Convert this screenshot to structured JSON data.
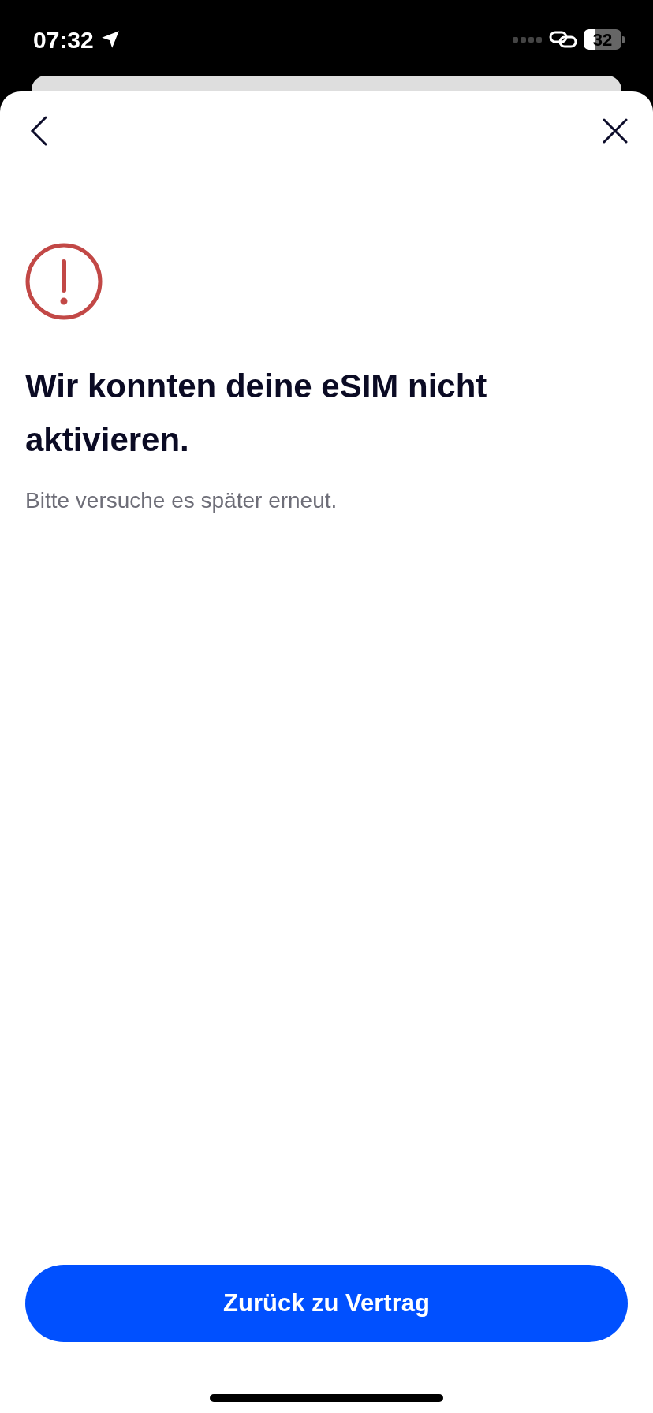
{
  "status_bar": {
    "time": "07:32",
    "battery": "32"
  },
  "title": "Wir konnten deine eSIM nicht aktivieren.",
  "message": "Bitte versuche es später erneut.",
  "button": "Zurück zu Vertrag"
}
